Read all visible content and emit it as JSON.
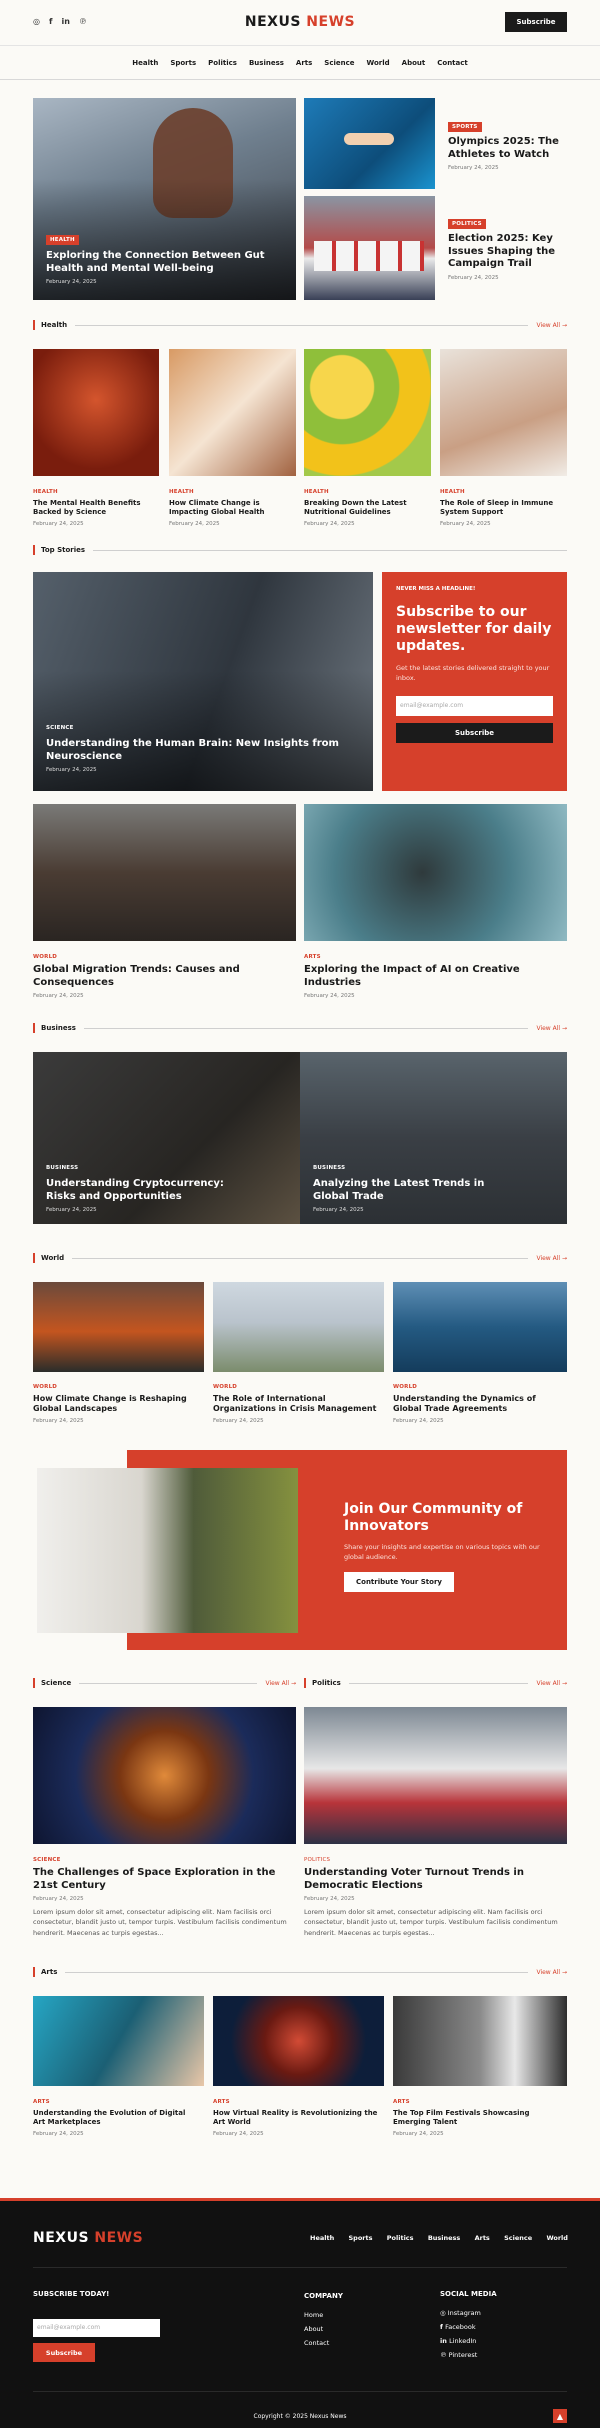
{
  "colors": {
    "accent": "#d6402b",
    "dark": "#111111",
    "bg": "#fbfaf6"
  },
  "header": {
    "social_icons": [
      "instagram-icon",
      "facebook-icon",
      "linkedin-icon",
      "pinterest-icon"
    ],
    "logo_a": "NEXUS",
    "logo_b": "NEWS",
    "subscribe": "Subscribe"
  },
  "nav": [
    "Health",
    "Sports",
    "Politics",
    "Business",
    "Arts",
    "Science",
    "World",
    "About",
    "Contact"
  ],
  "hero": {
    "tag": "HEALTH",
    "title": "Exploring the Connection Between Gut Health and Mental Well-being",
    "date": "February 24, 2025"
  },
  "side1": {
    "tag": "SPORTS",
    "title": "Olympics 2025: The Athletes to Watch",
    "date": "February 24, 2025"
  },
  "side2": {
    "tag": "POLITICS",
    "title": "Election 2025: Key Issues Shaping the Campaign Trail",
    "date": "February 24, 2025"
  },
  "health": {
    "name": "Health",
    "view": "View All →",
    "cards": [
      {
        "cat": "HEALTH",
        "title": "The Mental Health Benefits Backed by Science",
        "date": "February 24, 2025"
      },
      {
        "cat": "HEALTH",
        "title": "How Climate Change is Impacting Global Health",
        "date": "February 24, 2025"
      },
      {
        "cat": "HEALTH",
        "title": "Breaking Down the Latest Nutritional Guidelines",
        "date": "February 24, 2025"
      },
      {
        "cat": "HEALTH",
        "title": "The Role of Sleep in Immune System Support",
        "date": "February 24, 2025"
      }
    ]
  },
  "top": {
    "name": "Top Stories",
    "feature": {
      "tag": "SCIENCE",
      "title": "Understanding the Human Brain: New Insights from Neuroscience",
      "date": "February 24, 2025"
    },
    "newsletter": {
      "kicker": "NEVER MISS A HEADLINE!",
      "title": "Subscribe to our newsletter for daily updates.",
      "text": "Get the latest stories delivered straight to your inbox.",
      "placeholder": "email@example.com",
      "button": "Subscribe"
    },
    "cards": [
      {
        "cat": "WORLD",
        "title": "Global Migration Trends: Causes and Consequences",
        "date": "February 24, 2025"
      },
      {
        "cat": "ARTS",
        "title": "Exploring the Impact of AI on Creative Industries",
        "date": "February 24, 2025"
      }
    ]
  },
  "business": {
    "name": "Business",
    "view": "View All →",
    "cards": [
      {
        "tag": "BUSINESS",
        "title": "Understanding Cryptocurrency: Risks and Opportunities",
        "date": "February 24, 2025"
      },
      {
        "tag": "BUSINESS",
        "title": "Analyzing the Latest Trends in Global Trade",
        "date": "February 24, 2025"
      }
    ]
  },
  "world": {
    "name": "World",
    "view": "View All →",
    "cards": [
      {
        "cat": "WORLD",
        "title": "How Climate Change is Reshaping Global Landscapes",
        "date": "February 24, 2025"
      },
      {
        "cat": "WORLD",
        "title": "The Role of International Organizations in Crisis Management",
        "date": "February 24, 2025"
      },
      {
        "cat": "WORLD",
        "title": "Understanding the Dynamics of Global Trade Agreements",
        "date": "February 24, 2025"
      }
    ]
  },
  "community": {
    "title": "Join Our Community of Innovators",
    "text": "Share your insights and expertise on various topics with our global audience.",
    "button": "Contribute Your Story"
  },
  "science": {
    "name": "Science",
    "view": "View All →",
    "cat": "SCIENCE",
    "title": "The Challenges of Space Exploration in the 21st Century",
    "date": "February 24, 2025",
    "text": "Lorem ipsum dolor sit amet, consectetur adipiscing elit. Nam facilisis orci consectetur, blandit justo ut, tempor turpis. Vestibulum facilisis condimentum hendrerit. Maecenas ac turpis egestas..."
  },
  "politics": {
    "name": "Politics",
    "view": "View All →",
    "cat": "POLITICS",
    "title": "Understanding Voter Turnout Trends in Democratic Elections",
    "date": "February 24, 2025",
    "text": "Lorem ipsum dolor sit amet, consectetur adipiscing elit. Nam facilisis orci consectetur, blandit justo ut, tempor turpis. Vestibulum facilisis condimentum hendrerit. Maecenas ac turpis egestas..."
  },
  "arts": {
    "name": "Arts",
    "view": "View All →",
    "cards": [
      {
        "cat": "ARTS",
        "title": "Understanding the Evolution of Digital Art Marketplaces",
        "date": "February 24, 2025"
      },
      {
        "cat": "ARTS",
        "title": "How Virtual Reality is Revolutionizing the Art World",
        "date": "February 24, 2025"
      },
      {
        "cat": "ARTS",
        "title": "The Top Film Festivals Showcasing Emerging Talent",
        "date": "February 24, 2025"
      }
    ]
  },
  "footer": {
    "logo_a": "NEXUS",
    "logo_b": "NEWS",
    "nav": [
      "Health",
      "Sports",
      "Politics",
      "Business",
      "Arts",
      "Science",
      "World"
    ],
    "subscribe_title": "SUBSCRIBE TODAY!",
    "placeholder": "email@example.com",
    "button": "Subscribe",
    "company_title": "COMPANY",
    "company": [
      "Home",
      "About",
      "Contact"
    ],
    "social_title": "SOCIAL MEDIA",
    "social": [
      "Instagram",
      "Facebook",
      "LinkedIn",
      "Pinterest"
    ],
    "copyright": "Copyright © 2025 Nexus News",
    "top_icon": "arrow-up-icon"
  }
}
